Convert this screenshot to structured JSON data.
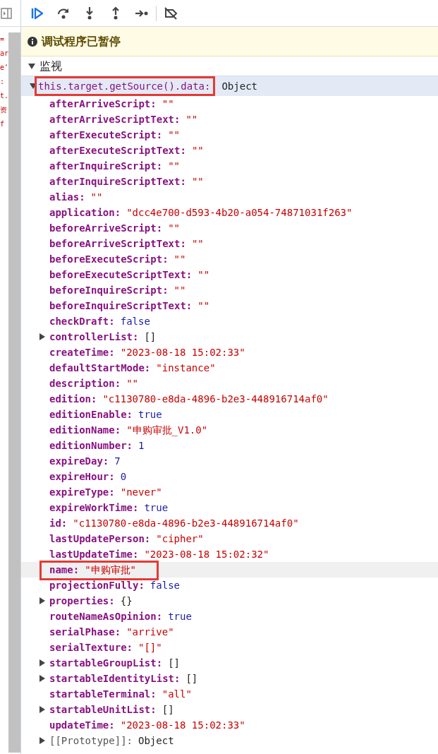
{
  "left_pane": {
    "fragments": [
      "=",
      "ar",
      "e'",
      ":",
      "t.",
      "资",
      "f"
    ]
  },
  "toolbar": {
    "buttons": [
      {
        "kind": "resume",
        "active": true
      },
      {
        "kind": "step-over",
        "active": false
      },
      {
        "kind": "step-into",
        "active": false
      },
      {
        "kind": "step-out",
        "active": false
      },
      {
        "kind": "step",
        "active": false
      },
      {
        "kind": "deactivate",
        "active": false
      }
    ]
  },
  "banner": {
    "text": "调试程序已暂停"
  },
  "section": {
    "title": "监视",
    "expanded": true
  },
  "watch": {
    "expression": "this.target.getSource().data:",
    "value": "Object",
    "expanded": true,
    "selected": true,
    "annotated": true
  },
  "properties": [
    {
      "key": "afterArriveScript:",
      "value": "\"\"",
      "kind": "string"
    },
    {
      "key": "afterArriveScriptText:",
      "value": "\"\"",
      "kind": "string"
    },
    {
      "key": "afterExecuteScript:",
      "value": "\"\"",
      "kind": "string"
    },
    {
      "key": "afterExecuteScriptText:",
      "value": "\"\"",
      "kind": "string"
    },
    {
      "key": "afterInquireScript:",
      "value": "\"\"",
      "kind": "string"
    },
    {
      "key": "afterInquireScriptText:",
      "value": "\"\"",
      "kind": "string"
    },
    {
      "key": "alias:",
      "value": "\"\"",
      "kind": "string"
    },
    {
      "key": "application:",
      "value": "\"dcc4e700-d593-4b20-a054-74871031f263\"",
      "kind": "string"
    },
    {
      "key": "beforeArriveScript:",
      "value": "\"\"",
      "kind": "string"
    },
    {
      "key": "beforeArriveScriptText:",
      "value": "\"\"",
      "kind": "string"
    },
    {
      "key": "beforeExecuteScript:",
      "value": "\"\"",
      "kind": "string"
    },
    {
      "key": "beforeExecuteScriptText:",
      "value": "\"\"",
      "kind": "string"
    },
    {
      "key": "beforeInquireScript:",
      "value": "\"\"",
      "kind": "string"
    },
    {
      "key": "beforeInquireScriptText:",
      "value": "\"\"",
      "kind": "string"
    },
    {
      "key": "checkDraft:",
      "value": "false",
      "kind": "literal"
    },
    {
      "key": "controllerList:",
      "value": "[]",
      "kind": "object"
    },
    {
      "key": "createTime:",
      "value": "\"2023-08-18 15:02:33\"",
      "kind": "string"
    },
    {
      "key": "defaultStartMode:",
      "value": "\"instance\"",
      "kind": "string"
    },
    {
      "key": "description:",
      "value": "\"\"",
      "kind": "string"
    },
    {
      "key": "edition:",
      "value": "\"c1130780-e8da-4896-b2e3-448916714af0\"",
      "kind": "string"
    },
    {
      "key": "editionEnable:",
      "value": "true",
      "kind": "literal"
    },
    {
      "key": "editionName:",
      "value": "\"申购审批_V1.0\"",
      "kind": "string"
    },
    {
      "key": "editionNumber:",
      "value": "1",
      "kind": "literal"
    },
    {
      "key": "expireDay:",
      "value": "7",
      "kind": "literal"
    },
    {
      "key": "expireHour:",
      "value": "0",
      "kind": "literal"
    },
    {
      "key": "expireType:",
      "value": "\"never\"",
      "kind": "string"
    },
    {
      "key": "expireWorkTime:",
      "value": "true",
      "kind": "literal"
    },
    {
      "key": "id:",
      "value": "\"c1130780-e8da-4896-b2e3-448916714af0\"",
      "kind": "string"
    },
    {
      "key": "lastUpdatePerson:",
      "value": "\"cipher\"",
      "kind": "string"
    },
    {
      "key": "lastUpdateTime:",
      "value": "\"2023-08-18 15:02:32\"",
      "kind": "string"
    },
    {
      "key": "name:",
      "value": "\"申购审批\"",
      "kind": "string",
      "selected": true,
      "annotated": true
    },
    {
      "key": "projectionFully:",
      "value": "false",
      "kind": "literal"
    },
    {
      "key": "properties:",
      "value": "{}",
      "kind": "object"
    },
    {
      "key": "routeNameAsOpinion:",
      "value": "true",
      "kind": "literal"
    },
    {
      "key": "serialPhase:",
      "value": "\"arrive\"",
      "kind": "string"
    },
    {
      "key": "serialTexture:",
      "value": "\"[]\"",
      "kind": "string"
    },
    {
      "key": "startableGroupList:",
      "value": "[]",
      "kind": "object"
    },
    {
      "key": "startableIdentityList:",
      "value": "[]",
      "kind": "object"
    },
    {
      "key": "startableTerminal:",
      "value": "\"all\"",
      "kind": "string"
    },
    {
      "key": "startableUnitList:",
      "value": "[]",
      "kind": "object"
    },
    {
      "key": "updateTime:",
      "value": "\"2023-08-18 15:02:33\"",
      "kind": "string"
    },
    {
      "key": "[[Prototype]]:",
      "value": "Object",
      "kind": "internal"
    }
  ]
}
